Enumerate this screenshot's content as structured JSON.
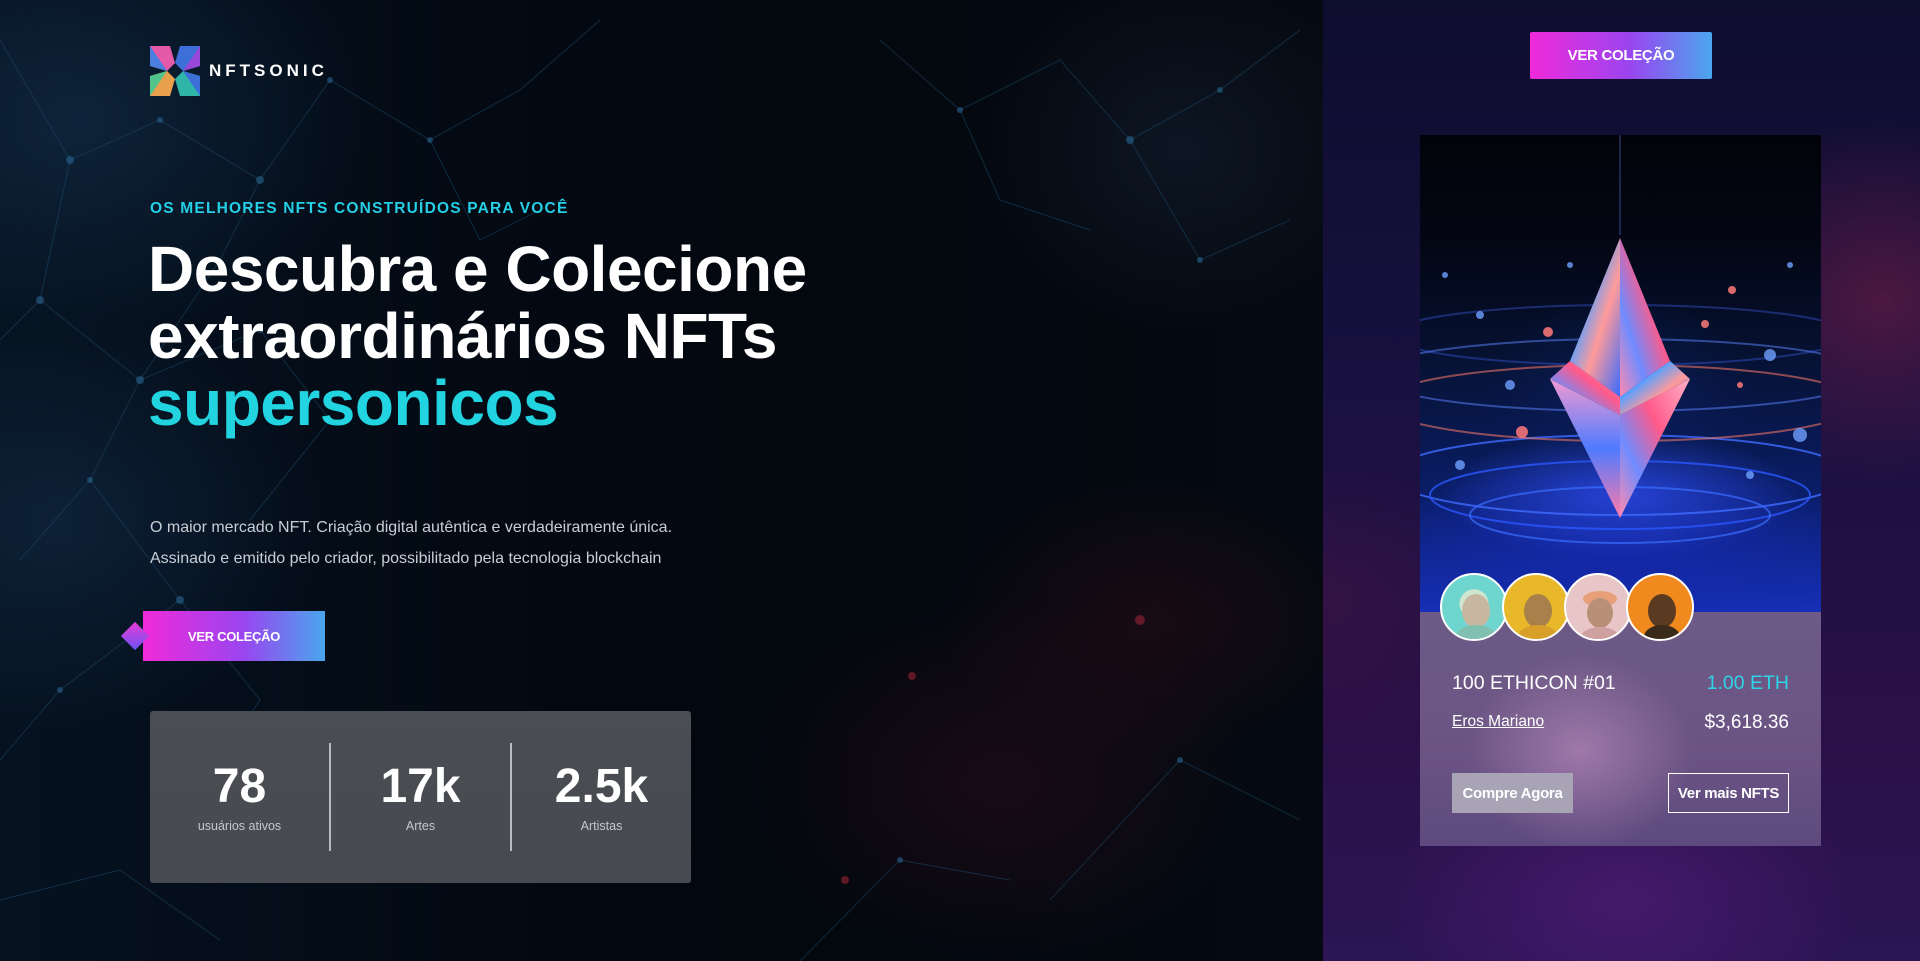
{
  "brand": {
    "name": "NFTSONIC",
    "logo_icon": "nftsonic-logo-icon"
  },
  "header": {
    "cta_label": "VER COLEÇÃO"
  },
  "hero": {
    "eyebrow": "OS MELHORES NFTS CONSTRUÍDOS PARA VOCÊ",
    "headline_line1": "Descubra e Colecione",
    "headline_line2": "extraordinários NFTs",
    "headline_accent": "supersonicos",
    "description_line1": "O maior mercado NFT. Criação digital autêntica e verdadeiramente única.",
    "description_line2": "Assinado e emitido pelo criador, possibilitado pela tecnologia blockchain",
    "cta_label": "VER COLEÇÃO"
  },
  "stats": [
    {
      "value": "78",
      "label": "usuários ativos"
    },
    {
      "value": "17k",
      "label": "Artes"
    },
    {
      "value": "2.5k",
      "label": "Artistas"
    }
  ],
  "nft_card": {
    "title": "100 ETHICON #01",
    "price_eth": "1.00 ETH",
    "owner": "Eros Mariano",
    "price_usd": "$3,618.36",
    "buy_label": "Compre Agora",
    "more_label": "Ver mais NFTS",
    "art_icon": "ethereum-crystal-art"
  },
  "colors": {
    "accent_cyan": "#22d3e0",
    "gradient_start": "#f02ad9",
    "gradient_end": "#4aa6ee"
  }
}
